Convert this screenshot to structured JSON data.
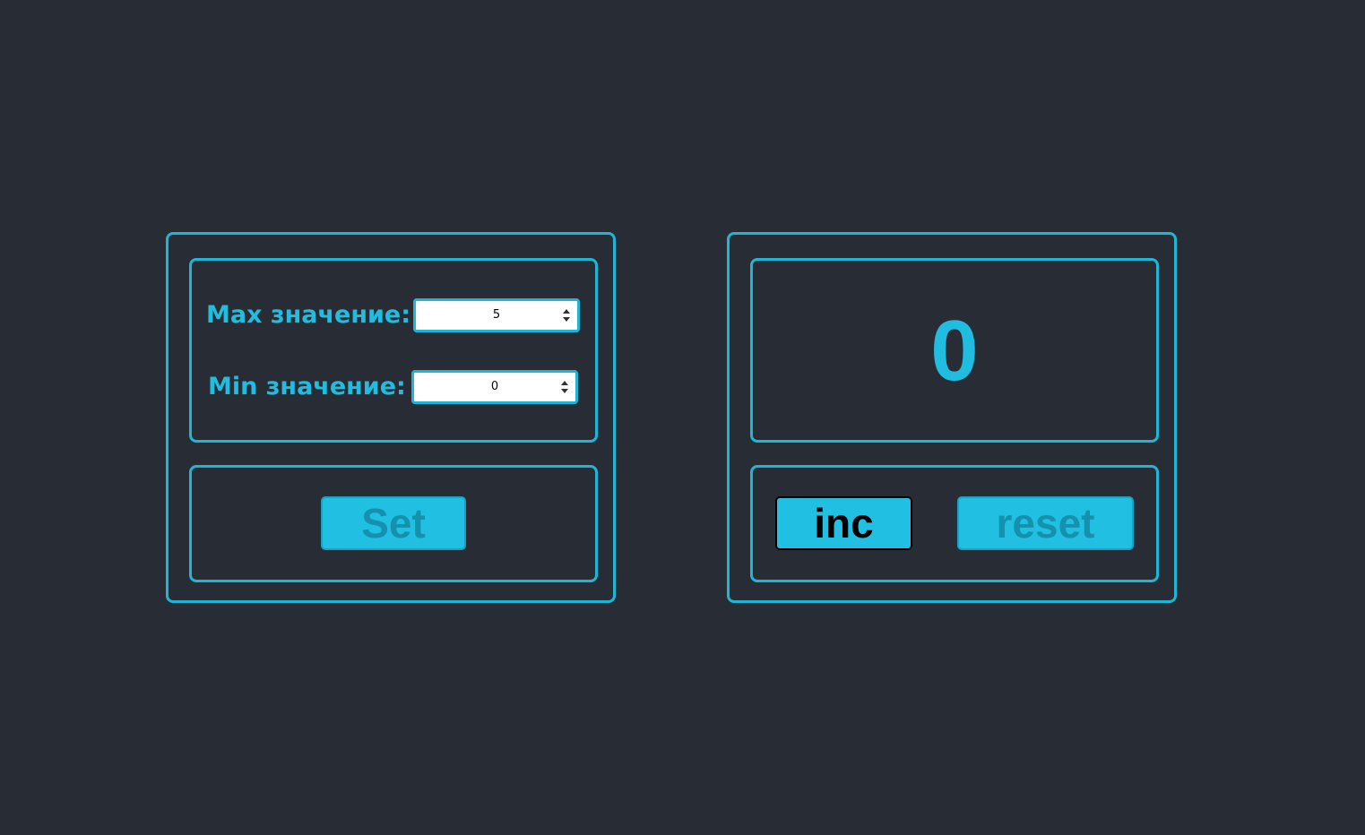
{
  "settings": {
    "max_label": "Max значение:",
    "max_value": "5",
    "min_label": "Min значение:",
    "min_value": "0",
    "set_label": "Set",
    "set_disabled": true
  },
  "counter": {
    "value": "0",
    "inc_label": "inc",
    "inc_disabled": false,
    "reset_label": "reset",
    "reset_disabled": true
  },
  "colors": {
    "background": "#282c34",
    "accent": "#20bde0",
    "button_bg": "#21c0e2",
    "disabled_text": "#1590ad"
  }
}
